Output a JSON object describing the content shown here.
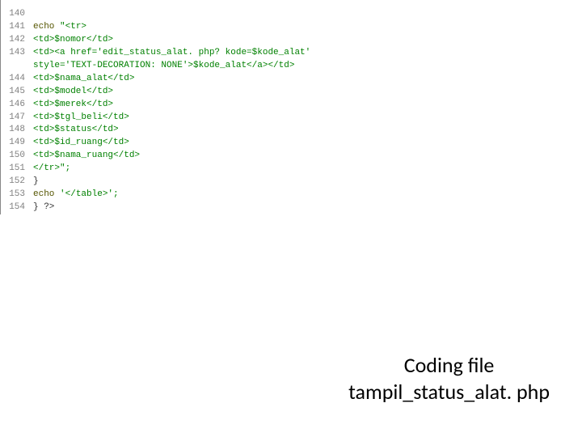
{
  "caption": {
    "line1": "Coding file",
    "line2": "tampil_status_alat. php"
  },
  "code": {
    "lines": [
      {
        "num": "140",
        "text": ""
      },
      {
        "num": "141",
        "text": "            echo \"<tr>",
        "echoPrefix": true
      },
      {
        "num": "142",
        "text": "                    <td>$nomor</td>"
      },
      {
        "num": "143",
        "text": "                    <td><a href='edit_status_alat. php? kode=$kode_alat'"
      },
      {
        "num": "",
        "text": "                    style='TEXT-DECORATION: NONE'>$kode_alat</a></td>"
      },
      {
        "num": "144",
        "text": "                    <td>$nama_alat</td>"
      },
      {
        "num": "145",
        "text": "                    <td>$model</td>"
      },
      {
        "num": "146",
        "text": "                    <td>$merek</td>"
      },
      {
        "num": "147",
        "text": "                    <td>$tgl_beli</td>"
      },
      {
        "num": "148",
        "text": "                    <td>$status</td>"
      },
      {
        "num": "149",
        "text": "                    <td>$id_ruang</td>"
      },
      {
        "num": "150",
        "text": "                    <td>$nama_ruang</td>"
      },
      {
        "num": "151",
        "text": "                </tr>\";"
      },
      {
        "num": "152",
        "text": "      }",
        "plain": true
      },
      {
        "num": "153",
        "text": "      echo '</table>';",
        "echoPrefix2": true
      },
      {
        "num": "154",
        "text": "} ?>",
        "plain": true
      }
    ]
  }
}
